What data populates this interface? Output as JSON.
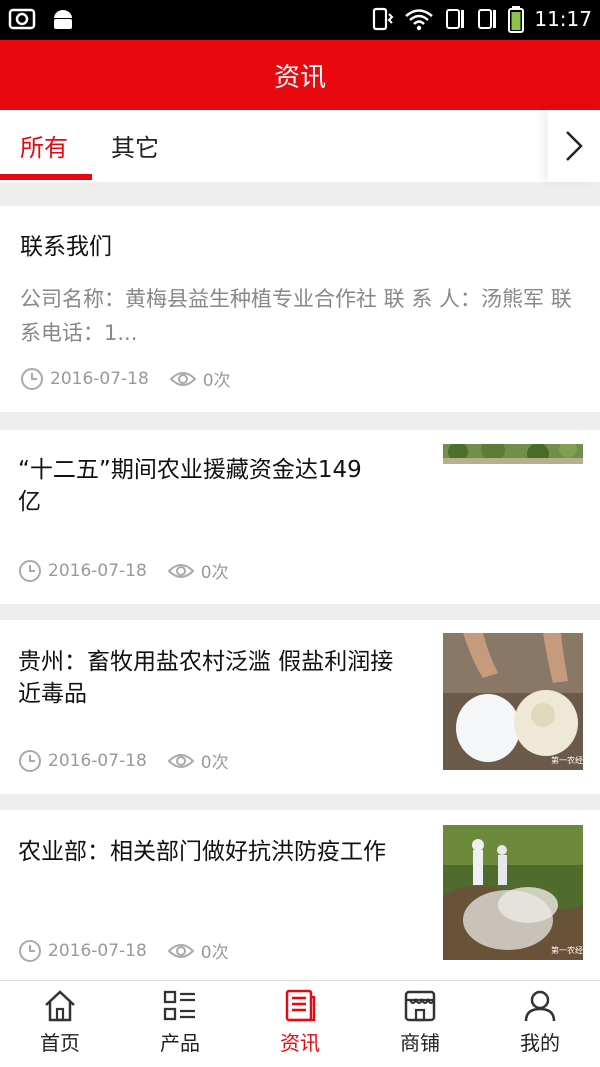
{
  "status_bar": {
    "time": "11:17"
  },
  "header": {
    "title": "资讯"
  },
  "tabs": [
    {
      "label": "所有",
      "active": true
    },
    {
      "label": "其它",
      "active": false
    }
  ],
  "articles": [
    {
      "title": "联系我们",
      "desc": " 公司名称：黄梅县益生种植专业合作社 联 系 人：汤熊军 联系电话：1...",
      "date": "2016-07-18",
      "views": "0次"
    },
    {
      "title": "“十二五”期间农业援藏资金达149亿",
      "date": "2016-07-18",
      "views": "0次",
      "thumb": "trees"
    },
    {
      "title": "贵州：畜牧用盐农村泛滥 假盐利润接近毒品",
      "date": "2016-07-18",
      "views": "0次",
      "thumb": "salt",
      "watermark": "第一农经"
    },
    {
      "title": "农业部：相关部门做好抗洪防疫工作",
      "date": "2016-07-18",
      "views": "0次",
      "thumb": "disinfection",
      "watermark": "第一农经"
    }
  ],
  "bottom_nav": [
    {
      "label": "首页",
      "icon": "home-icon"
    },
    {
      "label": "产品",
      "icon": "grid-list-icon"
    },
    {
      "label": "资讯",
      "icon": "news-icon",
      "active": true
    },
    {
      "label": "商铺",
      "icon": "shop-icon"
    },
    {
      "label": "我的",
      "icon": "user-icon"
    }
  ],
  "colors": {
    "accent": "#e8080f",
    "text_muted": "#999999"
  }
}
